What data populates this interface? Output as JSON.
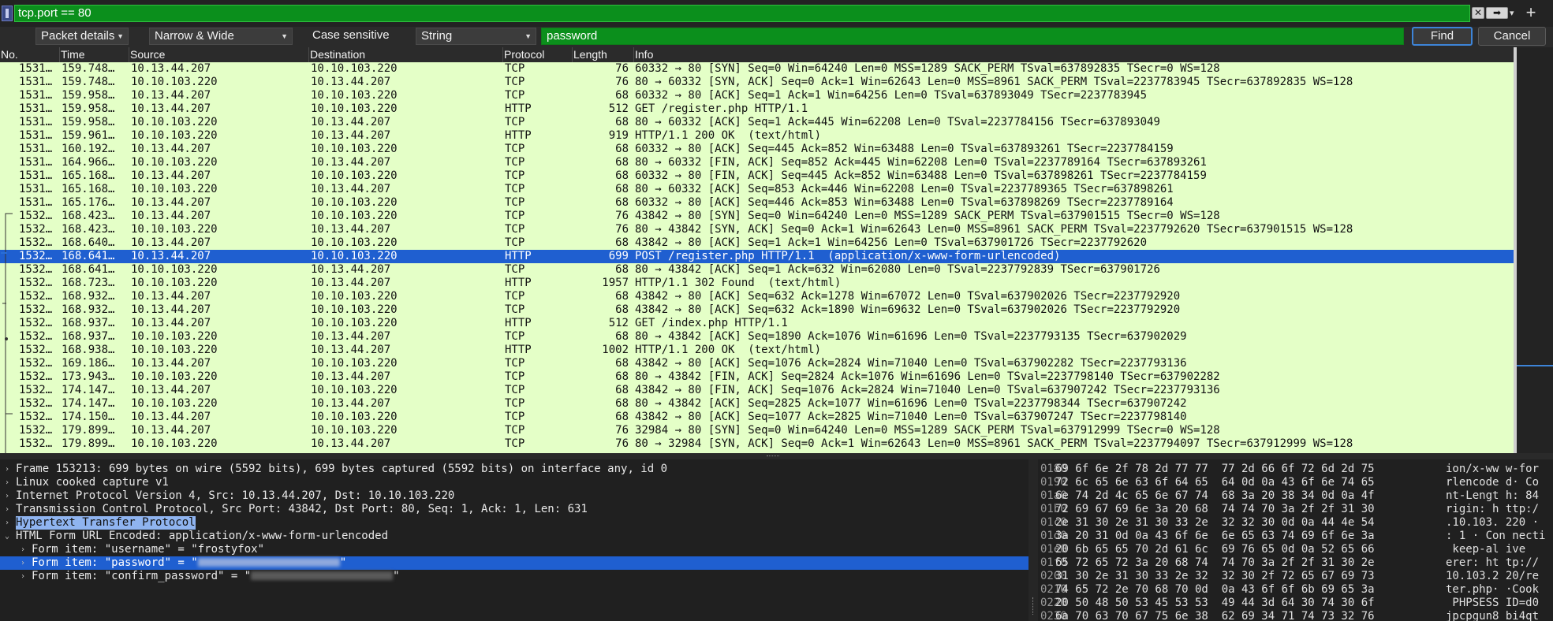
{
  "filter": {
    "expression": "tcp.port == 80",
    "clear_icon": "✕",
    "apply_icon": "➡"
  },
  "find": {
    "search_in": "Packet details",
    "char_width": "Narrow & Wide",
    "case_sensitive": "Case sensitive",
    "search_type": "String",
    "search_text": "password",
    "find_label": "Find",
    "cancel_label": "Cancel"
  },
  "packet_list": {
    "columns": [
      "No.",
      "Time",
      "Source",
      "Destination",
      "Protocol",
      "Length",
      "Info"
    ],
    "rows": [
      [
        "1531…",
        "159.748…",
        "10.13.44.207",
        "10.10.103.220",
        "TCP",
        "76",
        "60332 → 80 [SYN] Seq=0 Win=64240 Len=0 MSS=1289 SACK_PERM TSval=637892835 TSecr=0 WS=128"
      ],
      [
        "1531…",
        "159.748…",
        "10.10.103.220",
        "10.13.44.207",
        "TCP",
        "76",
        "80 → 60332 [SYN, ACK] Seq=0 Ack=1 Win=62643 Len=0 MSS=8961 SACK_PERM TSval=2237783945 TSecr=637892835 WS=128"
      ],
      [
        "1531…",
        "159.958…",
        "10.13.44.207",
        "10.10.103.220",
        "TCP",
        "68",
        "60332 → 80 [ACK] Seq=1 Ack=1 Win=64256 Len=0 TSval=637893049 TSecr=2237783945"
      ],
      [
        "1531…",
        "159.958…",
        "10.13.44.207",
        "10.10.103.220",
        "HTTP",
        "512",
        "GET /register.php HTTP/1.1"
      ],
      [
        "1531…",
        "159.958…",
        "10.10.103.220",
        "10.13.44.207",
        "TCP",
        "68",
        "80 → 60332 [ACK] Seq=1 Ack=445 Win=62208 Len=0 TSval=2237784156 TSecr=637893049"
      ],
      [
        "1531…",
        "159.961…",
        "10.10.103.220",
        "10.13.44.207",
        "HTTP",
        "919",
        "HTTP/1.1 200 OK  (text/html)"
      ],
      [
        "1531…",
        "160.192…",
        "10.13.44.207",
        "10.10.103.220",
        "TCP",
        "68",
        "60332 → 80 [ACK] Seq=445 Ack=852 Win=63488 Len=0 TSval=637893261 TSecr=2237784159"
      ],
      [
        "1531…",
        "164.966…",
        "10.10.103.220",
        "10.13.44.207",
        "TCP",
        "68",
        "80 → 60332 [FIN, ACK] Seq=852 Ack=445 Win=62208 Len=0 TSval=2237789164 TSecr=637893261"
      ],
      [
        "1531…",
        "165.168…",
        "10.13.44.207",
        "10.10.103.220",
        "TCP",
        "68",
        "60332 → 80 [FIN, ACK] Seq=445 Ack=852 Win=63488 Len=0 TSval=637898261 TSecr=2237784159"
      ],
      [
        "1531…",
        "165.168…",
        "10.10.103.220",
        "10.13.44.207",
        "TCP",
        "68",
        "80 → 60332 [ACK] Seq=853 Ack=446 Win=62208 Len=0 TSval=2237789365 TSecr=637898261"
      ],
      [
        "1531…",
        "165.176…",
        "10.13.44.207",
        "10.10.103.220",
        "TCP",
        "68",
        "60332 → 80 [ACK] Seq=446 Ack=853 Win=63488 Len=0 TSval=637898269 TSecr=2237789164"
      ],
      [
        "1532…",
        "168.423…",
        "10.13.44.207",
        "10.10.103.220",
        "TCP",
        "76",
        "43842 → 80 [SYN] Seq=0 Win=64240 Len=0 MSS=1289 SACK_PERM TSval=637901515 TSecr=0 WS=128"
      ],
      [
        "1532…",
        "168.423…",
        "10.10.103.220",
        "10.13.44.207",
        "TCP",
        "76",
        "80 → 43842 [SYN, ACK] Seq=0 Ack=1 Win=62643 Len=0 MSS=8961 SACK_PERM TSval=2237792620 TSecr=637901515 WS=128"
      ],
      [
        "1532…",
        "168.640…",
        "10.13.44.207",
        "10.10.103.220",
        "TCP",
        "68",
        "43842 → 80 [ACK] Seq=1 Ack=1 Win=64256 Len=0 TSval=637901726 TSecr=2237792620"
      ],
      [
        "1532…",
        "168.641…",
        "10.13.44.207",
        "10.10.103.220",
        "HTTP",
        "699",
        "POST /register.php HTTP/1.1  (application/x-www-form-urlencoded)"
      ],
      [
        "1532…",
        "168.641…",
        "10.10.103.220",
        "10.13.44.207",
        "TCP",
        "68",
        "80 → 43842 [ACK] Seq=1 Ack=632 Win=62080 Len=0 TSval=2237792839 TSecr=637901726"
      ],
      [
        "1532…",
        "168.723…",
        "10.10.103.220",
        "10.13.44.207",
        "HTTP",
        "1957",
        "HTTP/1.1 302 Found  (text/html)"
      ],
      [
        "1532…",
        "168.932…",
        "10.13.44.207",
        "10.10.103.220",
        "TCP",
        "68",
        "43842 → 80 [ACK] Seq=632 Ack=1278 Win=67072 Len=0 TSval=637902026 TSecr=2237792920"
      ],
      [
        "1532…",
        "168.932…",
        "10.13.44.207",
        "10.10.103.220",
        "TCP",
        "68",
        "43842 → 80 [ACK] Seq=632 Ack=1890 Win=69632 Len=0 TSval=637902026 TSecr=2237792920"
      ],
      [
        "1532…",
        "168.937…",
        "10.13.44.207",
        "10.10.103.220",
        "HTTP",
        "512",
        "GET /index.php HTTP/1.1"
      ],
      [
        "1532…",
        "168.937…",
        "10.10.103.220",
        "10.13.44.207",
        "TCP",
        "68",
        "80 → 43842 [ACK] Seq=1890 Ack=1076 Win=61696 Len=0 TSval=2237793135 TSecr=637902029"
      ],
      [
        "1532…",
        "168.938…",
        "10.10.103.220",
        "10.13.44.207",
        "HTTP",
        "1002",
        "HTTP/1.1 200 OK  (text/html)"
      ],
      [
        "1532…",
        "169.186…",
        "10.13.44.207",
        "10.10.103.220",
        "TCP",
        "68",
        "43842 → 80 [ACK] Seq=1076 Ack=2824 Win=71040 Len=0 TSval=637902282 TSecr=2237793136"
      ],
      [
        "1532…",
        "173.943…",
        "10.10.103.220",
        "10.13.44.207",
        "TCP",
        "68",
        "80 → 43842 [FIN, ACK] Seq=2824 Ack=1076 Win=61696 Len=0 TSval=2237798140 TSecr=637902282"
      ],
      [
        "1532…",
        "174.147…",
        "10.13.44.207",
        "10.10.103.220",
        "TCP",
        "68",
        "43842 → 80 [FIN, ACK] Seq=1076 Ack=2824 Win=71040 Len=0 TSval=637907242 TSecr=2237793136"
      ],
      [
        "1532…",
        "174.147…",
        "10.10.103.220",
        "10.13.44.207",
        "TCP",
        "68",
        "80 → 43842 [ACK] Seq=2825 Ack=1077 Win=61696 Len=0 TSval=2237798344 TSecr=637907242"
      ],
      [
        "1532…",
        "174.150…",
        "10.13.44.207",
        "10.10.103.220",
        "TCP",
        "68",
        "43842 → 80 [ACK] Seq=1077 Ack=2825 Win=71040 Len=0 TSval=637907247 TSecr=2237798140"
      ],
      [
        "1532…",
        "179.899…",
        "10.13.44.207",
        "10.10.103.220",
        "TCP",
        "76",
        "32984 → 80 [SYN] Seq=0 Win=64240 Len=0 MSS=1289 SACK_PERM TSval=637912999 TSecr=0 WS=128"
      ],
      [
        "1532…",
        "179.899…",
        "10.10.103.220",
        "10.13.44.207",
        "TCP",
        "76",
        "80 → 32984 [SYN, ACK] Seq=0 Ack=1 Win=62643 Len=0 MSS=8961 SACK_PERM TSval=2237794097 TSecr=637912999 WS=128"
      ]
    ],
    "selected_index": 14
  },
  "details": {
    "rows": [
      {
        "indent": 0,
        "expander": "›",
        "text": "Frame 153213: 699 bytes on wire (5592 bits), 699 bytes captured (5592 bits) on interface any, id 0"
      },
      {
        "indent": 0,
        "expander": "›",
        "text": "Linux cooked capture v1"
      },
      {
        "indent": 0,
        "expander": "›",
        "text": "Internet Protocol Version 4, Src: 10.13.44.207, Dst: 10.10.103.220"
      },
      {
        "indent": 0,
        "expander": "›",
        "text": "Transmission Control Protocol, Src Port: 43842, Dst Port: 80, Seq: 1, Ack: 1, Len: 631"
      },
      {
        "indent": 0,
        "expander": "›",
        "text": "Hypertext Transfer Protocol"
      },
      {
        "indent": 0,
        "expander": "⌄",
        "text": "HTML Form URL Encoded: application/x-www-form-urlencoded"
      },
      {
        "indent": 1,
        "expander": "›",
        "text": "Form item: \"username\" = \"frostyfox\""
      },
      {
        "indent": 1,
        "expander": "›",
        "text": "Form item: \"password\" = \"",
        "suffix": "\""
      },
      {
        "indent": 1,
        "expander": "›",
        "text": "Form item: \"confirm_password\" = \"",
        "suffix": "\""
      }
    ]
  },
  "bytes": {
    "rows": [
      {
        "offset": "0180",
        "hex": "69 6f 6e 2f 78 2d 77 77  77 2d 66 6f 72 6d 2d 75",
        "ascii": "ion/x-ww w-for"
      },
      {
        "offset": "0190",
        "hex": "72 6c 65 6e 63 6f 64 65  64 0d 0a 43 6f 6e 74 65",
        "ascii": "rlencode d· Co"
      },
      {
        "offset": "01a0",
        "hex": "6e 74 2d 4c 65 6e 67 74  68 3a 20 38 34 0d 0a 4f",
        "ascii": "nt-Lengt h: 84"
      },
      {
        "offset": "01b0",
        "hex": "72 69 67 69 6e 3a 20 68  74 74 70 3a 2f 2f 31 30",
        "ascii": "rigin: h ttp:/"
      },
      {
        "offset": "01c0",
        "hex": "2e 31 30 2e 31 30 33 2e  32 32 30 0d 0a 44 4e 54",
        "ascii": ".10.103. 220 ·"
      },
      {
        "offset": "01d0",
        "hex": "3a 20 31 0d 0a 43 6f 6e  6e 65 63 74 69 6f 6e 3a",
        "ascii": ": 1 · Con necti"
      },
      {
        "offset": "01e0",
        "hex": "20 6b 65 65 70 2d 61 6c  69 76 65 0d 0a 52 65 66",
        "ascii": " keep-al ive"
      },
      {
        "offset": "01f0",
        "hex": "65 72 65 72 3a 20 68 74  74 70 3a 2f 2f 31 30 2e",
        "ascii": "erer: ht tp://"
      },
      {
        "offset": "0200",
        "hex": "31 30 2e 31 30 33 2e 32  32 30 2f 72 65 67 69 73",
        "ascii": "10.103.2 20/re"
      },
      {
        "offset": "0210",
        "hex": "74 65 72 2e 70 68 70 0d  0a 43 6f 6f 6b 69 65 3a",
        "ascii": "ter.php· ·Cook"
      },
      {
        "offset": "0220",
        "hex": "20 50 48 50 53 45 53 53  49 44 3d 64 30 74 30 6f",
        "ascii": " PHPSESS ID=d0"
      },
      {
        "offset": "0230",
        "hex": "6a 70 63 70 67 75 6e 38  62 69 34 71 74 73 32 76",
        "ascii": "jpcpgun8 bi4qt"
      }
    ]
  }
}
